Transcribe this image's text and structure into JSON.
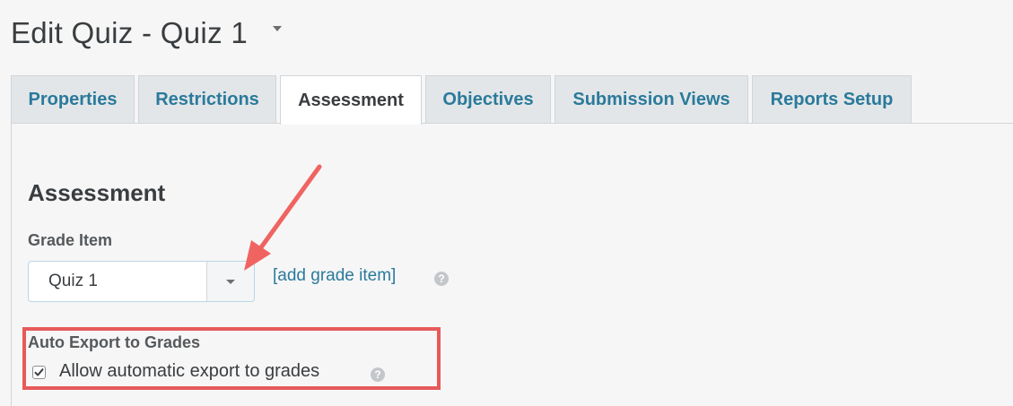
{
  "header": {
    "title": "Edit Quiz - Quiz 1"
  },
  "tabs": [
    {
      "label": "Properties",
      "active": false
    },
    {
      "label": "Restrictions",
      "active": false
    },
    {
      "label": "Assessment",
      "active": true
    },
    {
      "label": "Objectives",
      "active": false
    },
    {
      "label": "Submission Views",
      "active": false
    },
    {
      "label": "Reports Setup",
      "active": false
    }
  ],
  "assessment": {
    "heading": "Assessment",
    "grade_item_label": "Grade Item",
    "grade_item_value": "Quiz 1",
    "add_grade_item_link": "[add grade item]",
    "auto_export_label": "Auto Export to Grades",
    "auto_export_checkbox_label": "Allow automatic export to grades",
    "auto_export_checked": true
  },
  "colors": {
    "accent": "#2a7a9b",
    "annotation": "#e75a5a"
  }
}
